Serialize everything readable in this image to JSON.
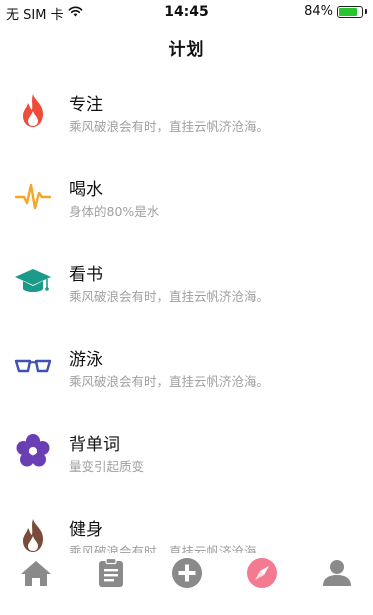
{
  "status_bar": {
    "carrier": "无 SIM 卡",
    "time": "14:45",
    "battery_percent": "84%",
    "battery_level": 0.84,
    "battery_color": "#29c530"
  },
  "header": {
    "title": "计划"
  },
  "plans": [
    {
      "title": "专注",
      "desc": "乘风破浪会有时，直挂云帆济沧海。",
      "icon": "flame-icon",
      "color": "#f04a3a"
    },
    {
      "title": "喝水",
      "desc": "身体的80%是水",
      "icon": "pulse-icon",
      "color": "#f5a623"
    },
    {
      "title": "看书",
      "desc": "乘风破浪会有时，直挂云帆济沧海。",
      "icon": "graduation-cap-icon",
      "color": "#1a9b8a"
    },
    {
      "title": "游泳",
      "desc": "乘风破浪会有时，直挂云帆济沧海。",
      "icon": "glasses-icon",
      "color": "#3f51b5"
    },
    {
      "title": "背单词",
      "desc": "量变引起质变",
      "icon": "flower-icon",
      "color": "#6a3fb3"
    },
    {
      "title": "健身",
      "desc": "乘风破浪会有时，直挂云帆济沧海。",
      "icon": "flame-icon",
      "color": "#7a4a3a"
    }
  ],
  "tab_bar": {
    "tabs": [
      {
        "icon": "home-icon",
        "active": false
      },
      {
        "icon": "clipboard-icon",
        "active": false
      },
      {
        "icon": "add-circle-icon",
        "active": false
      },
      {
        "icon": "compass-icon",
        "active": true
      },
      {
        "icon": "user-icon",
        "active": false
      }
    ],
    "inactive_color": "#8a8a8a",
    "active_color": "#f47a92"
  }
}
